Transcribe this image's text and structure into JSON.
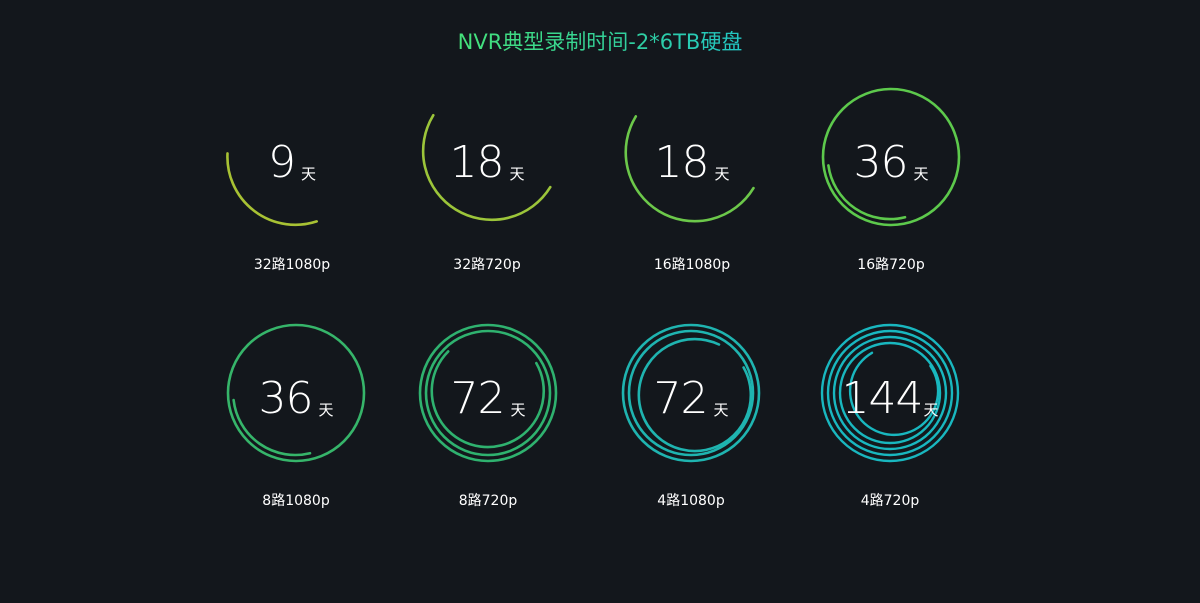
{
  "title": "NVR典型录制时间-2*6TB硬盘",
  "unit": "天",
  "items": [
    {
      "days": "9",
      "label": "32路1080p",
      "rings": 1,
      "fill": 0.5,
      "color": "#a8c234"
    },
    {
      "days": "18",
      "label": "32路720p",
      "rings": 1,
      "fill": 0.58,
      "color": "#9cc53a"
    },
    {
      "days": "18",
      "label": "16路1080p",
      "rings": 1,
      "fill": 0.55,
      "color": "#6cc84a"
    },
    {
      "days": "36",
      "label": "16路720p",
      "rings": 2,
      "fill": 1.0,
      "color": "#5dc94c"
    },
    {
      "days": "36",
      "label": "8路1080p",
      "rings": 2,
      "fill": 1.0,
      "color": "#36b56a"
    },
    {
      "days": "72",
      "label": "8路720p",
      "rings": 3,
      "fill": 1.0,
      "color": "#2fb26f"
    },
    {
      "days": "72",
      "label": "4路1080p",
      "rings": 3,
      "fill": 1.0,
      "color": "#1fb4b0"
    },
    {
      "days": "144",
      "label": "4路720p",
      "rings": 5,
      "fill": 1.0,
      "color": "#19b7bf"
    }
  ]
}
